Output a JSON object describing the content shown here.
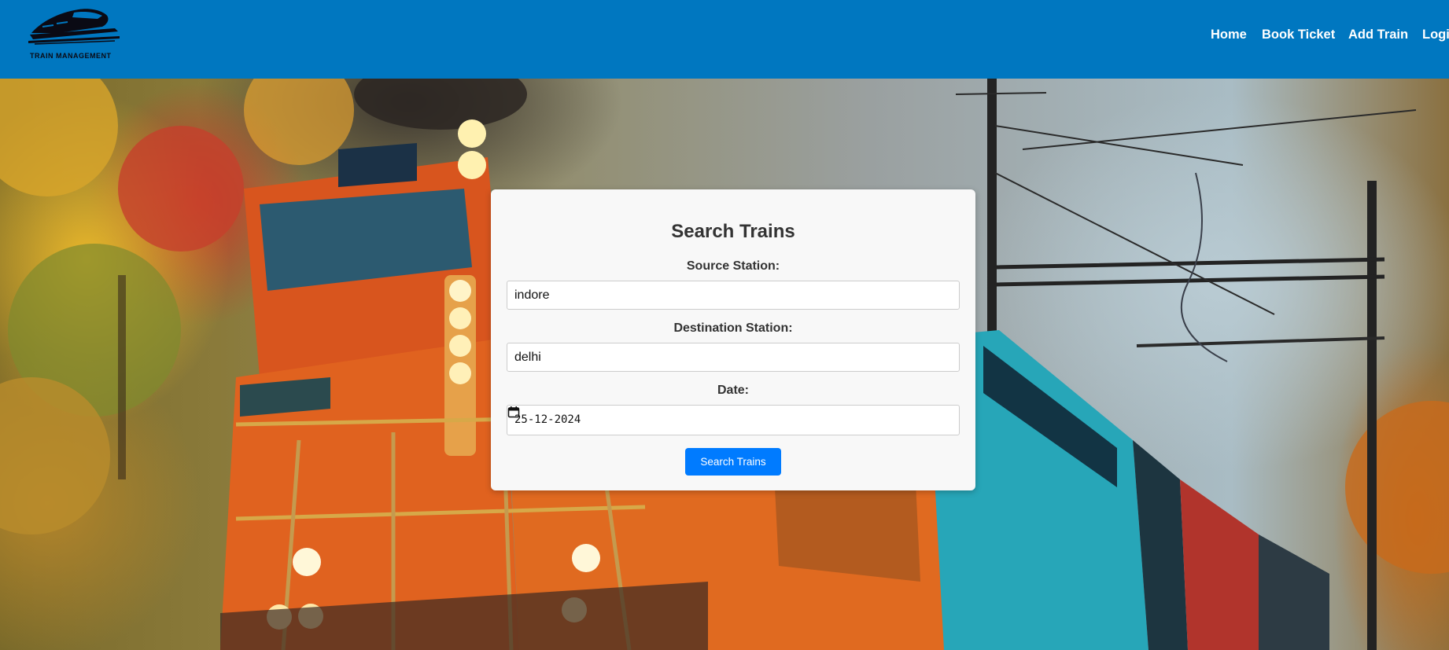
{
  "brand": {
    "logo_text": "TRAIN MANAGEMENT",
    "logo_icon": "bullet-train-icon"
  },
  "nav": {
    "items": [
      "Home",
      "Book Ticket",
      "Add Train",
      "Login"
    ]
  },
  "search_form": {
    "title": "Search Trains",
    "source_label": "Source Station:",
    "source_value": "indore",
    "destination_label": "Destination Station:",
    "destination_value": "delhi",
    "date_label": "Date:",
    "date_value": "25-12-2024",
    "date_icon": "calendar-icon",
    "submit_label": "Search Trains"
  },
  "colors": {
    "header_bg": "#0077c0",
    "button_bg": "#007bff",
    "card_bg": "#f8f8f8"
  }
}
